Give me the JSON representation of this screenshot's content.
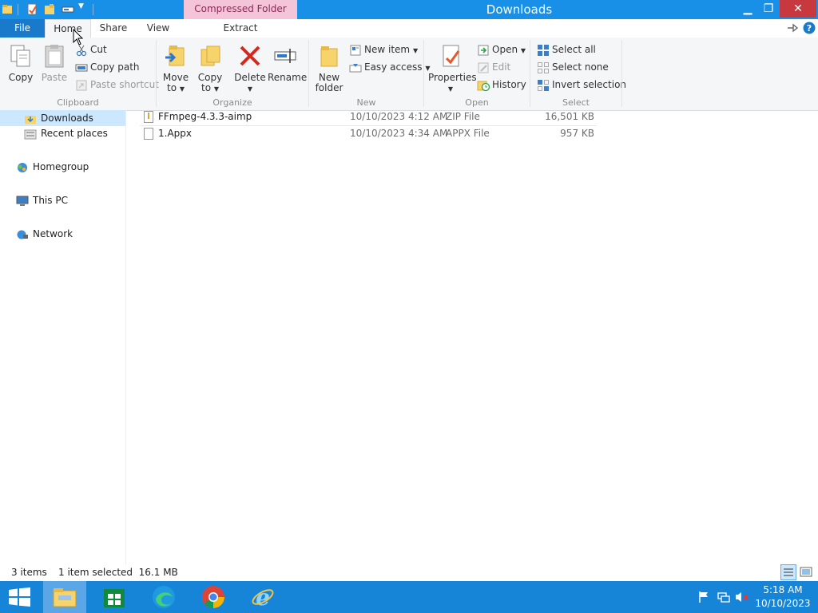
{
  "window": {
    "title": "Downloads",
    "context_tab_header": "Compressed Folder Tools"
  },
  "tabs": [
    {
      "label": "File"
    },
    {
      "label": "Home"
    },
    {
      "label": "Share"
    },
    {
      "label": "View"
    },
    {
      "label": "Extract"
    }
  ],
  "ribbon": {
    "clipboard": {
      "label": "Clipboard",
      "copy": "Copy",
      "paste": "Paste",
      "cut": "Cut",
      "copy_path": "Copy path",
      "paste_shortcut": "Paste shortcut"
    },
    "organize": {
      "label": "Organize",
      "move_to_1": "Move",
      "move_to_2": "to",
      "copy_to_1": "Copy",
      "copy_to_2": "to",
      "delete": "Delete",
      "rename": "Rename"
    },
    "new": {
      "label": "New",
      "new_folder_1": "New",
      "new_folder_2": "folder",
      "new_item": "New item",
      "easy_access": "Easy access"
    },
    "open": {
      "label": "Open",
      "properties": "Properties",
      "open": "Open",
      "edit": "Edit",
      "history": "History"
    },
    "select": {
      "label": "Select",
      "select_all": "Select all",
      "select_none": "Select none",
      "invert_selection": "Invert selection"
    }
  },
  "nav": {
    "downloads": "Downloads",
    "recent_places": "Recent places",
    "homegroup": "Homegroup",
    "this_pc": "This PC",
    "network": "Network"
  },
  "files": [
    {
      "name": "FFmpeg-4.3.3-aimp",
      "date": "10/10/2023 4:12 AM",
      "type": "ZIP File",
      "size": "16,501 KB"
    },
    {
      "name": "1.Appx",
      "date": "10/10/2023 4:34 AM",
      "type": "APPX File",
      "size": "957 KB"
    }
  ],
  "status": {
    "items": "3 items",
    "selected": "1 item selected  16.1 MB"
  },
  "taskbar": {
    "time": "5:18 AM",
    "date": "10/10/2023"
  },
  "colors": {
    "titlebar": "#1990e8",
    "file_tab": "#1979ca",
    "context_header": "#f4c4d8",
    "taskbar": "#1685d8",
    "selection": "#cce8ff"
  }
}
